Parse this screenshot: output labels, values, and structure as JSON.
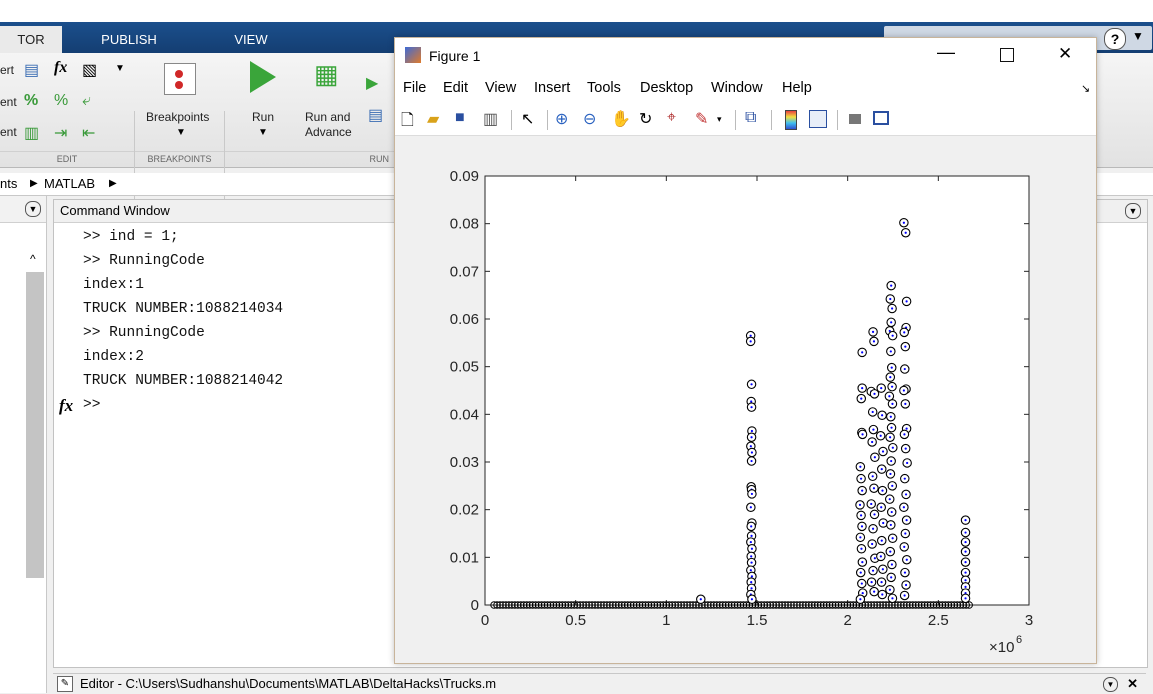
{
  "toolstrip": {
    "tabs": [
      "TOR",
      "PUBLISH",
      "VIEW"
    ],
    "edit_rows": [
      "ert",
      "ent",
      "ent"
    ],
    "edit_group_label": "EDIT",
    "breakpoints_label": "Breakpoints",
    "breakpoints_group_label": "BREAKPOINTS",
    "run_label": "Run",
    "run_advance_label_1": "Run and",
    "run_advance_label_2": "Advance",
    "run_group_label": "RUN"
  },
  "address": {
    "crumb_1": "nts",
    "crumb_2": "MATLAB"
  },
  "command_window": {
    "title": "Command Window",
    "lines": [
      ">> ind = 1;",
      ">> RunningCode",
      "index:1",
      "TRUCK NUMBER:1088214034",
      ">> RunningCode",
      "index:2",
      "TRUCK NUMBER:1088214042",
      ">>"
    ],
    "fx_label": "fx"
  },
  "editor_bar": {
    "label": "Editor - C:\\Users\\Sudhanshu\\Documents\\MATLAB\\DeltaHacks\\Trucks.m"
  },
  "figure": {
    "title": "Figure 1",
    "menu": [
      "File",
      "Edit",
      "View",
      "Insert",
      "Tools",
      "Desktop",
      "Window",
      "Help"
    ],
    "toolbar_icons": [
      "new-figure-icon",
      "open-file-icon",
      "save-icon",
      "print-icon",
      "pointer-icon",
      "zoom-in-icon",
      "zoom-out-icon",
      "pan-icon",
      "rotate-icon",
      "data-cursor-icon",
      "brush-icon",
      "link-icon",
      "colorbar-icon",
      "legend-icon",
      "hide-plot-tools-icon",
      "show-plot-tools-icon"
    ]
  },
  "chart_data": {
    "type": "scatter",
    "title": "",
    "xlabel": "",
    "ylabel": "",
    "xlim": [
      0,
      3000000
    ],
    "ylim": [
      0,
      0.09
    ],
    "x_ticks": [
      0,
      0.5,
      1,
      1.5,
      2,
      2.5,
      3
    ],
    "x_tick_labels": [
      "0",
      "0.5",
      "1",
      "1.5",
      "2",
      "2.5",
      "3"
    ],
    "x_multiplier": "×10",
    "x_exponent": "6",
    "y_ticks": [
      0,
      0.01,
      0.02,
      0.03,
      0.04,
      0.05,
      0.06,
      0.07,
      0.08,
      0.09
    ],
    "y_tick_labels": [
      "0",
      "0.01",
      "0.02",
      "0.03",
      "0.04",
      "0.05",
      "0.06",
      "0.07",
      "0.08",
      "0.09"
    ],
    "grid": false,
    "marker": "circle-with-dot",
    "marker_color": "#000000",
    "dot_color": "#0000ff",
    "points": [
      [
        1190000,
        0.0012
      ],
      [
        1465000,
        0.0565
      ],
      [
        1465000,
        0.0553
      ],
      [
        1470000,
        0.0463
      ],
      [
        1468000,
        0.0427
      ],
      [
        1470000,
        0.0415
      ],
      [
        1472000,
        0.0365
      ],
      [
        1470000,
        0.0352
      ],
      [
        1466000,
        0.0333
      ],
      [
        1472000,
        0.032
      ],
      [
        1470000,
        0.0302
      ],
      [
        1468000,
        0.0248
      ],
      [
        1470000,
        0.0242
      ],
      [
        1472000,
        0.0233
      ],
      [
        1466000,
        0.0205
      ],
      [
        1472000,
        0.0172
      ],
      [
        1468000,
        0.0165
      ],
      [
        1470000,
        0.0145
      ],
      [
        1466000,
        0.0132
      ],
      [
        1472000,
        0.0118
      ],
      [
        1468000,
        0.0102
      ],
      [
        1470000,
        0.0089
      ],
      [
        1466000,
        0.0073
      ],
      [
        1472000,
        0.006
      ],
      [
        1468000,
        0.0048
      ],
      [
        1470000,
        0.0035
      ],
      [
        1466000,
        0.0022
      ],
      [
        1472000,
        0.0012
      ],
      [
        2080000,
        0.053
      ],
      [
        2080000,
        0.0455
      ],
      [
        2075000,
        0.0433
      ],
      [
        2078000,
        0.0362
      ],
      [
        2082000,
        0.0358
      ],
      [
        2070000,
        0.029
      ],
      [
        2074000,
        0.0265
      ],
      [
        2080000,
        0.024
      ],
      [
        2068000,
        0.021
      ],
      [
        2074000,
        0.0188
      ],
      [
        2079000,
        0.0165
      ],
      [
        2070000,
        0.0142
      ],
      [
        2076000,
        0.0118
      ],
      [
        2081000,
        0.009
      ],
      [
        2072000,
        0.0068
      ],
      [
        2078000,
        0.0045
      ],
      [
        2083000,
        0.0025
      ],
      [
        2070000,
        0.0012
      ],
      [
        2140000,
        0.0573
      ],
      [
        2145000,
        0.0553
      ],
      [
        2130000,
        0.0448
      ],
      [
        2148000,
        0.0443
      ],
      [
        2138000,
        0.0405
      ],
      [
        2142000,
        0.0368
      ],
      [
        2135000,
        0.0342
      ],
      [
        2150000,
        0.031
      ],
      [
        2138000,
        0.027
      ],
      [
        2145000,
        0.0245
      ],
      [
        2130000,
        0.0212
      ],
      [
        2148000,
        0.019
      ],
      [
        2140000,
        0.016
      ],
      [
        2135000,
        0.0128
      ],
      [
        2150000,
        0.0098
      ],
      [
        2140000,
        0.0072
      ],
      [
        2132000,
        0.0048
      ],
      [
        2146000,
        0.0028
      ],
      [
        2185000,
        0.0455
      ],
      [
        2190000,
        0.0398
      ],
      [
        2182000,
        0.0355
      ],
      [
        2195000,
        0.0322
      ],
      [
        2188000,
        0.0285
      ],
      [
        2192000,
        0.024
      ],
      [
        2185000,
        0.0205
      ],
      [
        2196000,
        0.0172
      ],
      [
        2188000,
        0.0135
      ],
      [
        2183000,
        0.0102
      ],
      [
        2194000,
        0.0075
      ],
      [
        2187000,
        0.0048
      ],
      [
        2191000,
        0.0022
      ],
      [
        2240000,
        0.067
      ],
      [
        2235000,
        0.0642
      ],
      [
        2245000,
        0.0622
      ],
      [
        2240000,
        0.0593
      ],
      [
        2232000,
        0.0575
      ],
      [
        2248000,
        0.0565
      ],
      [
        2238000,
        0.0532
      ],
      [
        2243000,
        0.0498
      ],
      [
        2235000,
        0.0478
      ],
      [
        2245000,
        0.0458
      ],
      [
        2230000,
        0.0438
      ],
      [
        2247000,
        0.0422
      ],
      [
        2238000,
        0.0395
      ],
      [
        2242000,
        0.0372
      ],
      [
        2234000,
        0.0352
      ],
      [
        2249000,
        0.033
      ],
      [
        2240000,
        0.0302
      ],
      [
        2236000,
        0.0275
      ],
      [
        2246000,
        0.025
      ],
      [
        2232000,
        0.0222
      ],
      [
        2243000,
        0.0195
      ],
      [
        2238000,
        0.0168
      ],
      [
        2248000,
        0.014
      ],
      [
        2235000,
        0.0112
      ],
      [
        2244000,
        0.0085
      ],
      [
        2240000,
        0.0058
      ],
      [
        2233000,
        0.0032
      ],
      [
        2247000,
        0.0014
      ],
      [
        2310000,
        0.0802
      ],
      [
        2320000,
        0.0781
      ],
      [
        2325000,
        0.0637
      ],
      [
        2322000,
        0.0582
      ],
      [
        2312000,
        0.0572
      ],
      [
        2318000,
        0.0542
      ],
      [
        2315000,
        0.0495
      ],
      [
        2322000,
        0.0453
      ],
      [
        2310000,
        0.045
      ],
      [
        2318000,
        0.0422
      ],
      [
        2325000,
        0.037
      ],
      [
        2313000,
        0.0358
      ],
      [
        2320000,
        0.0328
      ],
      [
        2328000,
        0.0298
      ],
      [
        2315000,
        0.0265
      ],
      [
        2322000,
        0.0232
      ],
      [
        2310000,
        0.0205
      ],
      [
        2325000,
        0.0178
      ],
      [
        2318000,
        0.015
      ],
      [
        2312000,
        0.0122
      ],
      [
        2326000,
        0.0095
      ],
      [
        2316000,
        0.0068
      ],
      [
        2322000,
        0.0042
      ],
      [
        2314000,
        0.002
      ],
      [
        2650000,
        0.0178
      ],
      [
        2650000,
        0.0152
      ],
      [
        2650000,
        0.0132
      ],
      [
        2650000,
        0.0112
      ],
      [
        2650000,
        0.009
      ],
      [
        2650000,
        0.0068
      ],
      [
        2650000,
        0.0052
      ],
      [
        2650000,
        0.0038
      ],
      [
        2650000,
        0.0025
      ],
      [
        2650000,
        0.0014
      ]
    ],
    "baseline_segment": {
      "x_from": 50000,
      "x_to": 2670000,
      "y": 0
    }
  }
}
